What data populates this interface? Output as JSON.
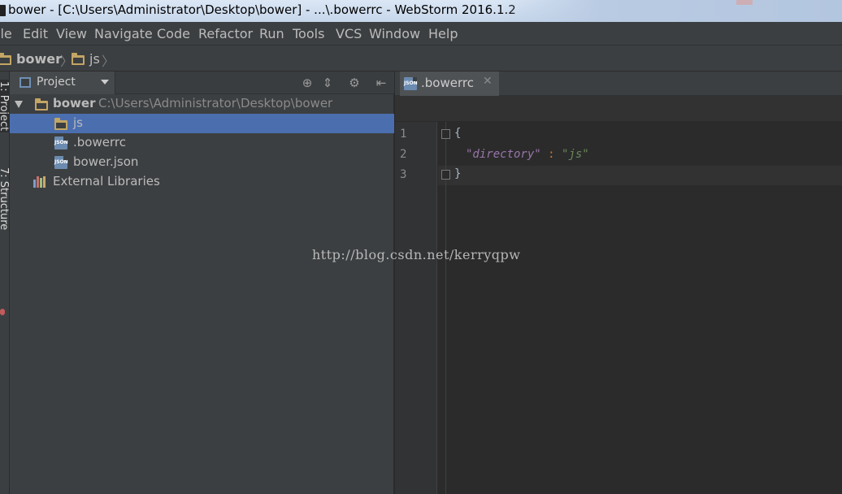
{
  "window": {
    "title": "bower - [C:\\Users\\Administrator\\Desktop\\bower] - ...\\.bowerrc - WebStorm 2016.1.2"
  },
  "menu": [
    {
      "label": "File"
    },
    {
      "label": "Edit"
    },
    {
      "label": "View"
    },
    {
      "label": "Navigate"
    },
    {
      "label": "Code"
    },
    {
      "label": "Refactor"
    },
    {
      "label": "Run"
    },
    {
      "label": "Tools"
    },
    {
      "label": "VCS"
    },
    {
      "label": "Window"
    },
    {
      "label": "Help"
    }
  ],
  "breadcrumb": [
    {
      "label": "bower",
      "icon": "folder-icon"
    },
    {
      "label": "js",
      "icon": "folder-icon"
    }
  ],
  "left_strip": {
    "tab1": "1: Project",
    "tab2": "7: Structure"
  },
  "project_panel": {
    "view_label": "Project",
    "tree": {
      "root_label": "bower",
      "root_path": "C:\\Users\\Administrator\\Desktop\\bower",
      "children": [
        {
          "label": "js",
          "icon": "folder-icon",
          "selected": true
        },
        {
          "label": ".bowerrc",
          "icon": "json-file-icon"
        },
        {
          "label": "bower.json",
          "icon": "json-file-icon"
        }
      ],
      "external_libraries": "External Libraries"
    }
  },
  "editor": {
    "tab_label": ".bowerrc",
    "tab_icon_text": "JSON",
    "line_numbers": [
      "1",
      "2",
      "3"
    ],
    "code": {
      "line1": "{",
      "line2_key": "\"directory\"",
      "line2_sep": " : ",
      "line2_val": "\"js\"",
      "line3": "}"
    }
  },
  "watermark": "http://blog.csdn.net/kerryqpw",
  "colors": {
    "selection": "#4b6eaf",
    "panel_bg": "#3c3f41",
    "editor_bg": "#2b2b2b",
    "json_key": "#9876aa",
    "json_string": "#6a8759"
  }
}
